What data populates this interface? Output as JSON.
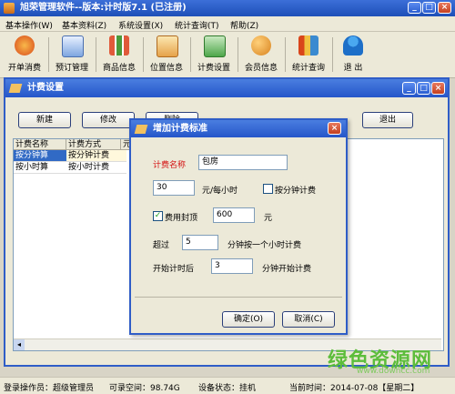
{
  "app": {
    "title": "旭荣管理软件--版本:计时版7.1 (已注册)"
  },
  "menu": [
    "基本操作(W)",
    "基本资料(Z)",
    "系统设置(X)",
    "统计查询(T)",
    "帮助(Z)"
  ],
  "toolbar": [
    {
      "label": "开单消费",
      "icon": "dollar-coin-icon"
    },
    {
      "label": "预订管理",
      "icon": "search-icon"
    },
    {
      "label": "商品信息",
      "icon": "grid-icon"
    },
    {
      "label": "位置信息",
      "icon": "house-card-icon"
    },
    {
      "label": "计费设置",
      "icon": "calculator-icon"
    },
    {
      "label": "会员信息",
      "icon": "users-icon"
    },
    {
      "label": "统计查询",
      "icon": "chart-icon"
    },
    {
      "label": "退 出",
      "icon": "exit-person-icon"
    }
  ],
  "child_window": {
    "title": "计费设置",
    "buttons": {
      "new": "新建",
      "edit": "修改",
      "delete": "删除",
      "exit": "退出"
    },
    "columns": [
      "计费名称",
      "计费方式",
      "元"
    ],
    "rows": [
      {
        "name": "按分钟算",
        "method": "按分钟计费"
      },
      {
        "name": "按小时算",
        "method": "按小时计费"
      }
    ]
  },
  "dialog": {
    "title": "增加计费标准",
    "name_label": "计费名称",
    "name_value": "包房",
    "rate_value": "30",
    "rate_unit": "元/每小时",
    "per_minute_label": "按分钟计费",
    "cap_label": "费用封顶",
    "cap_value": "600",
    "cap_unit": "元",
    "over_label": "超过",
    "over_value": "5",
    "over_suffix": "分钟按一个小时计费",
    "start_label": "开始计时后",
    "start_value": "3",
    "start_suffix": "分钟开始计费",
    "ok": "确定(O)",
    "cancel": "取消(C)"
  },
  "status": {
    "operator": "登录操作员：超级管理员",
    "space": "可录空间：98.74G",
    "device": "设备状态：挂机",
    "time": "当前时间：2014-07-08【星期二】"
  },
  "watermark": {
    "text": "绿色资源网",
    "url": "www.downcc.com",
    "color": "#5cbd3b"
  }
}
